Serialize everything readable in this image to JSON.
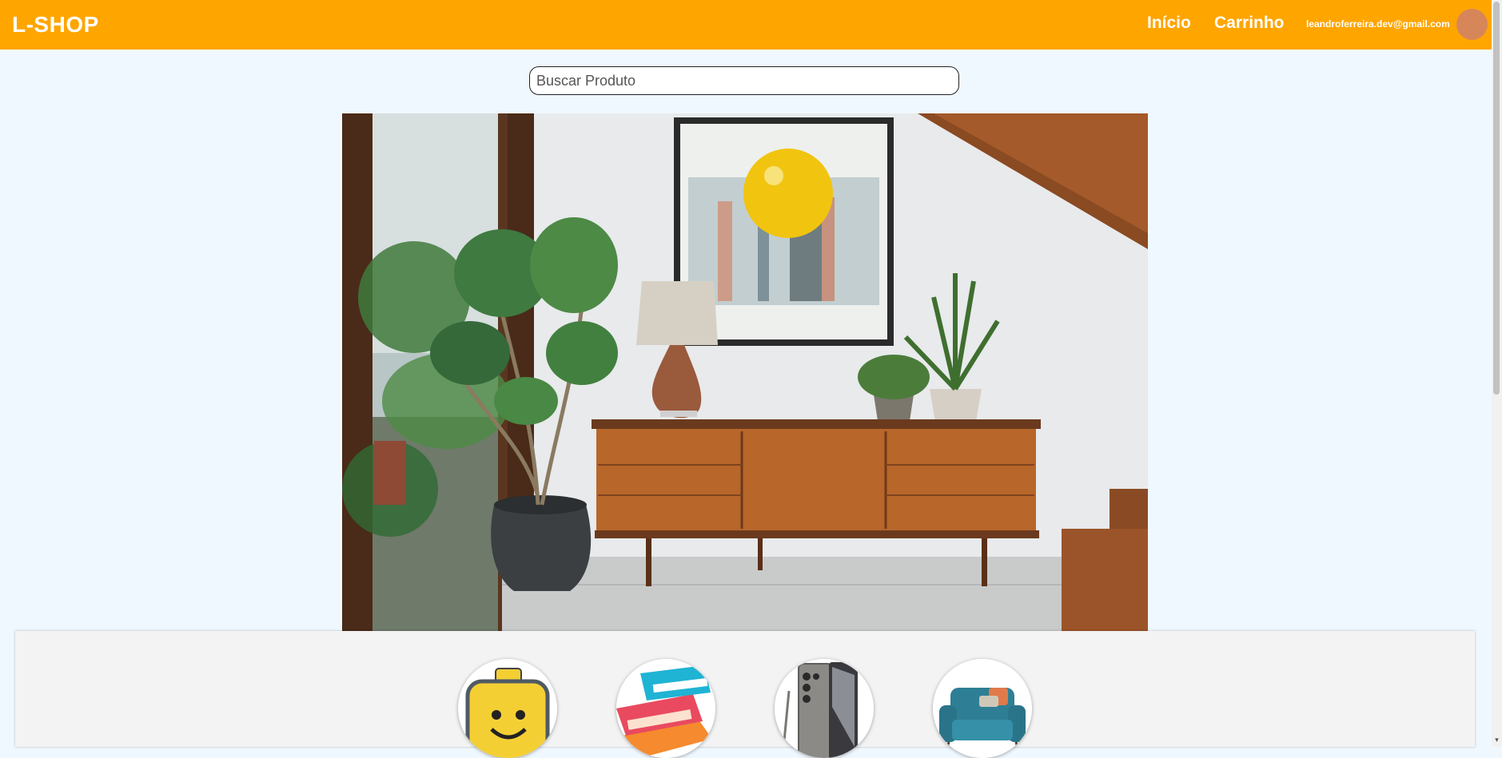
{
  "header": {
    "brand": "L-SHOP",
    "nav": [
      {
        "label": "Início"
      },
      {
        "label": "Carrinho"
      }
    ],
    "user_email": "leandroferreira.dev@gmail.com",
    "avatar_color": "#d7865a",
    "background_color": "#ffa500"
  },
  "search": {
    "placeholder": "Buscar Produto",
    "value": ""
  },
  "hero": {
    "image": "living-room-sideboard-photo"
  },
  "categories": [
    {
      "icon": "lego-head-icon"
    },
    {
      "icon": "books-icon"
    },
    {
      "icon": "smartphone-icon"
    },
    {
      "icon": "sofa-icon"
    }
  ],
  "colors": {
    "page_background": "#f0f8ff",
    "accent": "#ffa500"
  }
}
